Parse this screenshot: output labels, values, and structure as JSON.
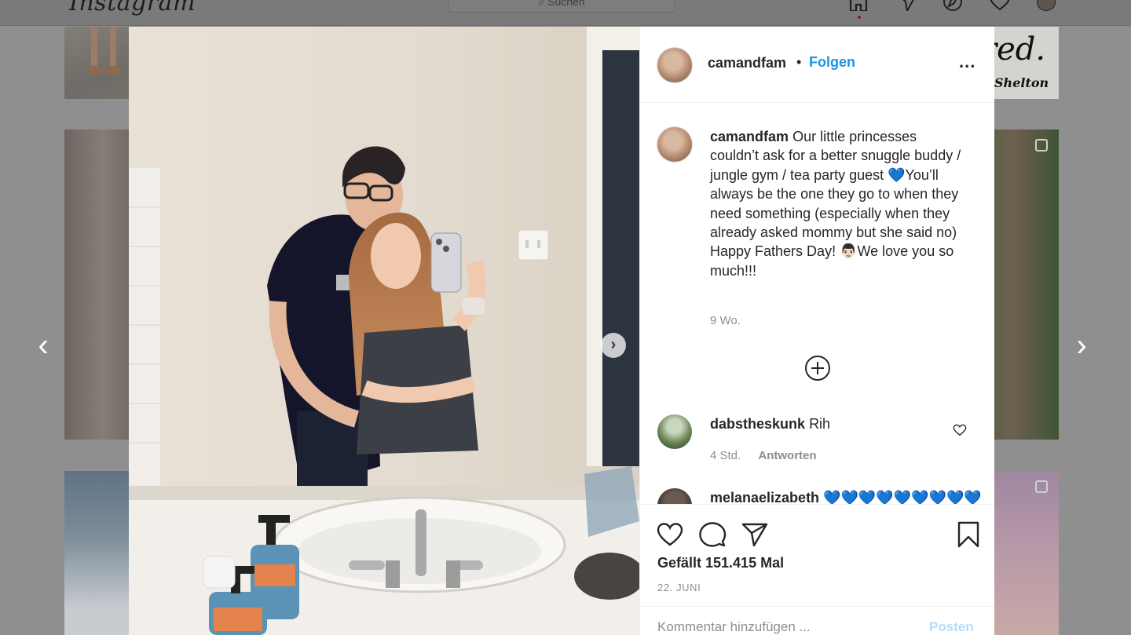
{
  "app": {
    "logo": "Instagram",
    "search_placeholder": "Suchen",
    "nav_icons": [
      "home-icon",
      "direct-icon",
      "explore-icon",
      "activity-icon",
      "profile-avatar"
    ]
  },
  "background": {
    "tile_text_big": "red.",
    "tile_text_small": "Shelton"
  },
  "modal": {
    "header": {
      "username": "camandfam",
      "separator": "•",
      "follow_label": "Folgen",
      "more_label": "..."
    },
    "caption": {
      "username": "camandfam",
      "text": "Our little princesses couldn’t ask for a better snuggle buddy / jungle gym / tea party guest 💙You’ll always be the one they go to when they need something (especially when they already asked mommy but she said no) Happy Fathers Day! 👨🏻We love you so much!!!",
      "time": "9 Wo."
    },
    "comments": [
      {
        "username": "dabstheskunk",
        "text": "Rih",
        "time": "4 Std.",
        "reply_label": "Antworten"
      },
      {
        "username": "melanaelizabeth",
        "text": "💙💙💙💙💙💙💙💙💙"
      }
    ],
    "likes_text": "Gefällt 151.415 Mal",
    "date": "22. JUNI",
    "add_comment_placeholder": "Kommentar hinzufügen ...",
    "post_label": "Posten"
  },
  "colors": {
    "accent": "#1795e8",
    "post_disabled": "#b2dffc",
    "text": "#262626",
    "muted": "#8e8e8e"
  }
}
